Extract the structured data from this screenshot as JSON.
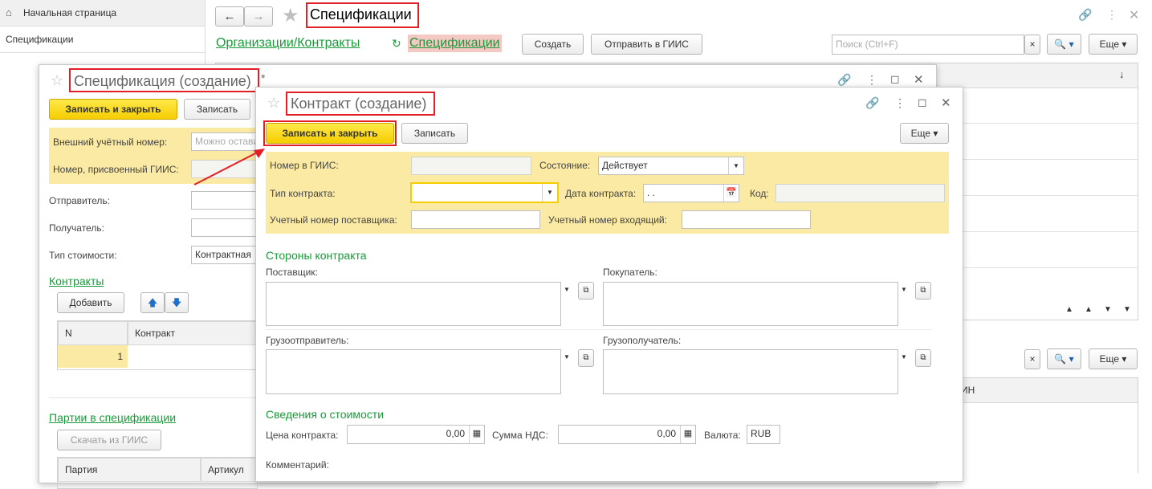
{
  "sidebar": {
    "home_label": "Начальная страница",
    "item_label": "Спецификации"
  },
  "main": {
    "title": "Спецификации",
    "nav_links": [
      "Организации/Контракты",
      "Спецификации"
    ],
    "create_label": "Создать",
    "send_label": "Отправить в ГИИС",
    "search_placeholder": "Поиск (Ctrl+F)",
    "more_label": "Еще",
    "more_label2": "Еще",
    "col_tail": "ИН"
  },
  "spec": {
    "title": "Спецификация (создание)",
    "modified_mark": "*",
    "save_close_label": "Записать и закрыть",
    "save_label": "Записать",
    "ext_number_label": "Внешний учётный номер:",
    "ext_number_placeholder": "Можно оставить",
    "giis_number_label": "Номер, присвоенный ГИИС:",
    "sender_label": "Отправитель:",
    "receiver_label": "Получатель:",
    "cost_type_label": "Тип стоимости:",
    "cost_type_value": "Контрактная",
    "contracts_group": "Контракты",
    "add_label": "Добавить",
    "contracts_cols": [
      "N",
      "Контракт"
    ],
    "contracts_row_n": "1",
    "batches_group": "Партии в спецификации",
    "download_label": "Скачать из ГИИС",
    "batches_cols": [
      "Партия",
      "Артикул"
    ]
  },
  "contract": {
    "title": "Контракт (создание)",
    "save_close_label": "Записать и закрыть",
    "save_label": "Записать",
    "more_label": "Еще",
    "giis_number_label": "Номер в ГИИС:",
    "state_label": "Состояние:",
    "state_value": "Действует",
    "type_label": "Тип контракта:",
    "date_label": "Дата контракта:",
    "date_value": " .  .",
    "code_label": "Код:",
    "supplier_num_label": "Учетный номер поставщика:",
    "incoming_num_label": "Учетный номер входящий:",
    "parties_group": "Стороны контракта",
    "supplier_label": "Поставщик:",
    "buyer_label": "Покупатель:",
    "shipper_label": "Грузоотправитель:",
    "consignee_label": "Грузополучатель:",
    "cost_group": "Сведения о стоимости",
    "price_label": "Цена контракта:",
    "price_value": "0,00",
    "vat_label": "Сумма НДС:",
    "vat_value": "0,00",
    "currency_label": "Валюта:",
    "currency_value": "RUB",
    "comment_label": "Комментарий:"
  },
  "colors": {
    "accent_green": "#1a9a3a",
    "highlight_red": "#e21f26",
    "button_yellow": "#f5cd00",
    "panel_yellow": "#fbeaa3"
  }
}
